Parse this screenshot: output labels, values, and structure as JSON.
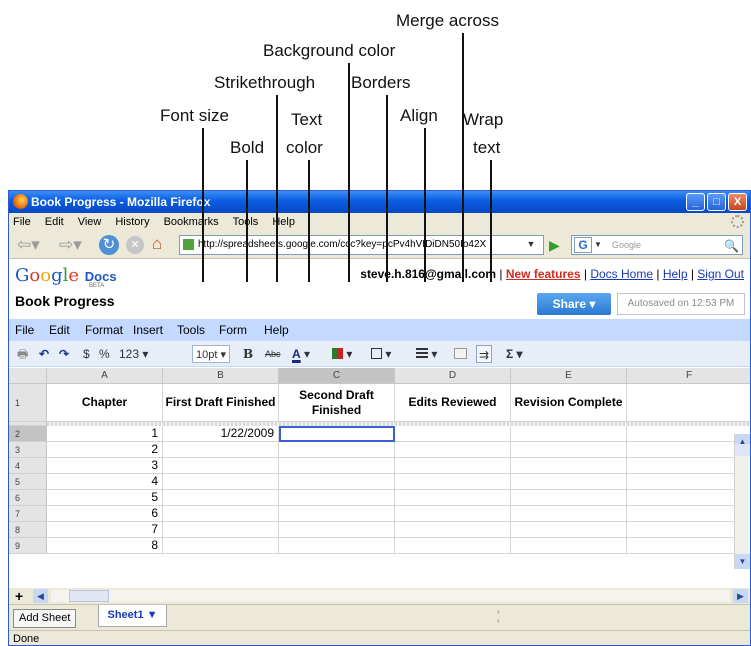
{
  "annotations": {
    "font_size": "Font size",
    "bold": "Bold",
    "strikethrough": "Strikethrough",
    "text_color_line1": "Text",
    "text_color_line2": "color",
    "background_color": "Background color",
    "borders": "Borders",
    "merge_across": "Merge across",
    "align": "Align",
    "wrap_text_line1": "Wrap",
    "wrap_text_line2": "text"
  },
  "window": {
    "title": "Book Progress - Mozilla Firefox",
    "controls": {
      "minimize": "_",
      "maximize": "□",
      "close": "X"
    }
  },
  "browser_menu": [
    "File",
    "Edit",
    "View",
    "History",
    "Bookmarks",
    "Tools",
    "Help"
  ],
  "nav": {
    "url": "http://spreadsheets.google.com/ccc?key=pcPv4hVIDiDN50Io42X",
    "search_placeholder": "Google",
    "search_engine_glyph": "G"
  },
  "docs": {
    "logo_google": [
      "G",
      "o",
      "o",
      "g",
      "l",
      "e"
    ],
    "logo_docs": "Docs",
    "logo_beta": "BETA",
    "email": "steve.h.816@gmail.com",
    "separator": " | ",
    "new_features": "New features",
    "docs_home": "Docs Home",
    "help": "Help",
    "sign_out": "Sign Out",
    "title": "Book Progress",
    "share_label": "Share ▾",
    "autosave_text": "Autosaved on 12:53 PM"
  },
  "app_menu": [
    "File",
    "Edit",
    "Format",
    "Insert",
    "Tools",
    "Form",
    "Help"
  ],
  "toolbar": {
    "print": "🖶",
    "undo": "↶",
    "redo": "↷",
    "currency": "$",
    "percent": "%",
    "number_format": "123 ▾",
    "font_size": "10pt ▾",
    "bold": "B",
    "strike": "Abc",
    "text_color": "A",
    "dropdown": "▾",
    "wrap": "⇉",
    "sum": "Σ ▾"
  },
  "grid": {
    "columns": [
      "A",
      "B",
      "C",
      "D",
      "E",
      "F"
    ],
    "selected_column": "C",
    "header_row_number": "1",
    "headers": [
      "Chapter",
      "First Draft Finished",
      "Second Draft Finished",
      "Edits Reviewed",
      "Revision Complete",
      ""
    ],
    "rows": [
      {
        "num": "2",
        "chapter": "1",
        "first_draft": "1/22/2009"
      },
      {
        "num": "3",
        "chapter": "2",
        "first_draft": ""
      },
      {
        "num": "4",
        "chapter": "3",
        "first_draft": ""
      },
      {
        "num": "5",
        "chapter": "4",
        "first_draft": ""
      },
      {
        "num": "6",
        "chapter": "5",
        "first_draft": ""
      },
      {
        "num": "7",
        "chapter": "6",
        "first_draft": ""
      },
      {
        "num": "8",
        "chapter": "7",
        "first_draft": ""
      },
      {
        "num": "9",
        "chapter": "8",
        "first_draft": ""
      }
    ]
  },
  "sheets": {
    "add_label": "Add Sheet",
    "active_tab": "Sheet1 ▼",
    "plus": "+"
  },
  "status": {
    "text": "Done"
  }
}
